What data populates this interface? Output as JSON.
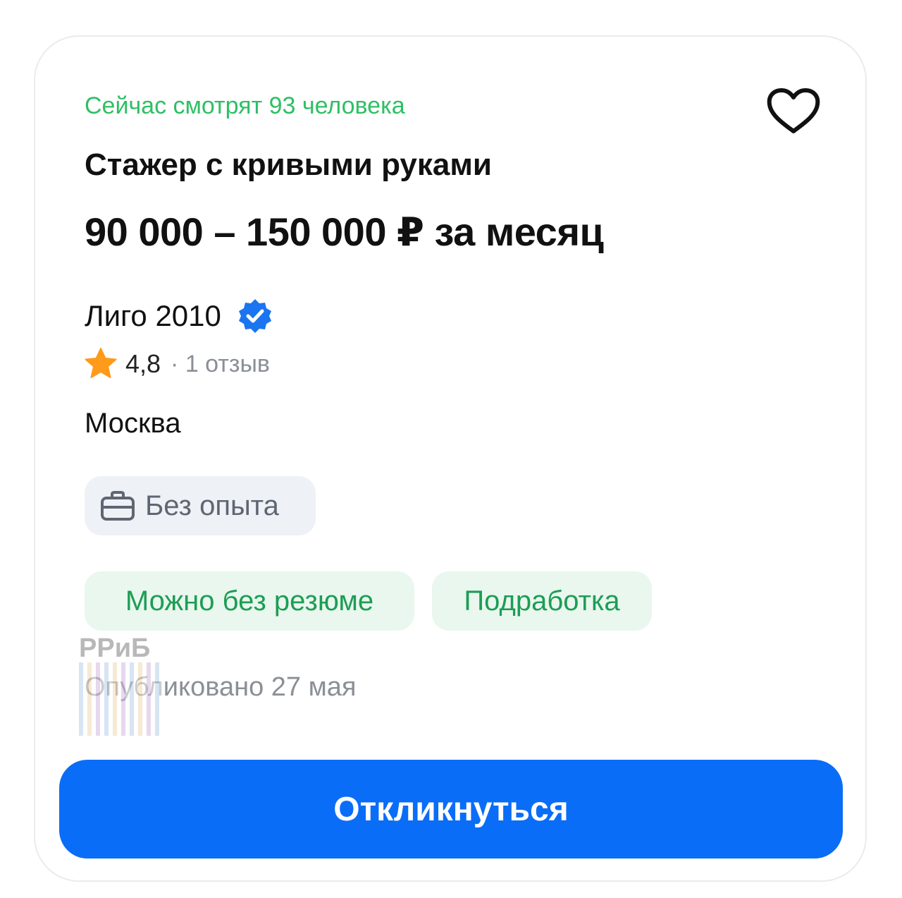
{
  "vacancy": {
    "watching_text": "Сейчас смотрят 93 человека",
    "title": "Стажер с кривыми руками",
    "salary": "90 000 – 150 000 ₽ за месяц",
    "company": {
      "name": "Лиго 2010",
      "verified": true,
      "rating": "4,8",
      "reviews": "· 1 отзыв"
    },
    "city": "Москва",
    "experience": "Без опыта",
    "tags": [
      "Можно без резюме",
      "Подработка"
    ],
    "published": "Опубликовано 27 мая",
    "apply_label": "Откликнуться"
  },
  "watermark_text": "РРиБ",
  "icons": {
    "favorite": "heart-icon",
    "verified": "verified-check-icon",
    "rating": "star-icon",
    "experience": "briefcase-icon"
  },
  "colors": {
    "accent_blue": "#0a6df7",
    "accent_green": "#2fbf65",
    "tag_green_bg": "#e9f7ee",
    "tag_green_text": "#1d9d55",
    "chip_gray_bg": "#eef1f5",
    "star_orange": "#ff9a1a"
  }
}
